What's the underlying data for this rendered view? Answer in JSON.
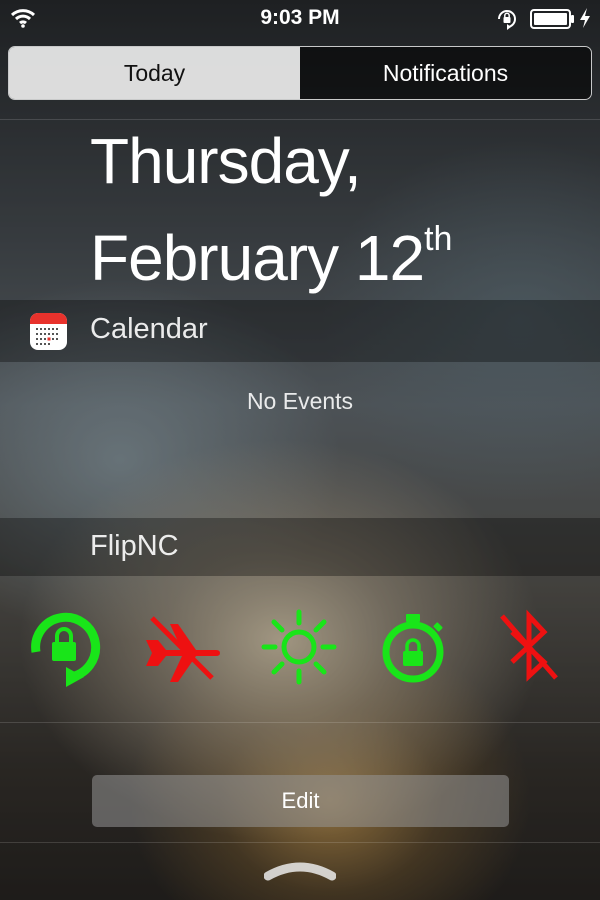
{
  "status_bar": {
    "time": "9:03 PM"
  },
  "tabs": [
    {
      "label": "Today",
      "selected": true
    },
    {
      "label": "Notifications",
      "selected": false
    }
  ],
  "date": {
    "line1": "Thursday,",
    "line2": "February 12",
    "suffix": "th"
  },
  "calendar": {
    "title": "Calendar",
    "message": "No Events"
  },
  "flipnc": {
    "title": "FlipNC",
    "toggles": [
      {
        "icon": "rotation-lock-icon",
        "state": "on",
        "color": "#19e519"
      },
      {
        "icon": "airplane-mode-icon",
        "state": "off",
        "color": "#ee1111"
      },
      {
        "icon": "brightness-icon",
        "state": "on",
        "color": "#19e519"
      },
      {
        "icon": "auto-lock-timer-icon",
        "state": "on",
        "color": "#19e519"
      },
      {
        "icon": "bluetooth-icon",
        "state": "off",
        "color": "#ee1111"
      }
    ]
  },
  "edit_label": "Edit",
  "colors": {
    "on": "#19e519",
    "off": "#ee1111"
  }
}
